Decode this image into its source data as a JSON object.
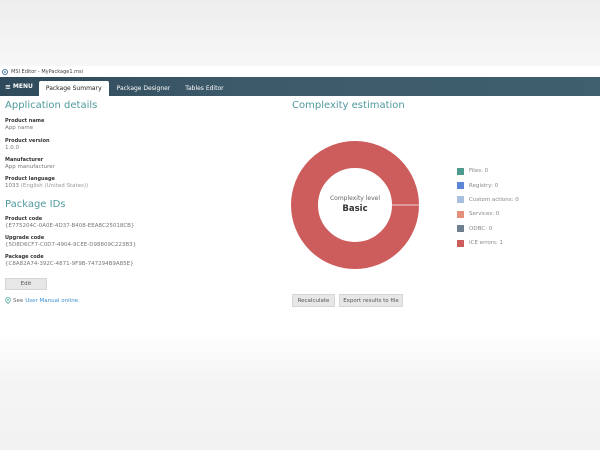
{
  "window": {
    "title": "MSI Editor - MyPackage1.msi"
  },
  "menu": {
    "menu_label": "MENU",
    "tabs": [
      {
        "label": "Package Summary",
        "active": true
      },
      {
        "label": "Package Designer",
        "active": false
      },
      {
        "label": "Tables Editor",
        "active": false
      }
    ]
  },
  "application_details": {
    "heading": "Application details",
    "product_name_label": "Product name",
    "product_name_value": "App name",
    "product_version_label": "Product version",
    "product_version_value": "1.0.0",
    "manufacturer_label": "Manufacturer",
    "manufacturer_value": "App manufacturer",
    "product_language_label": "Product language",
    "product_language_value": "1033",
    "product_language_hint": "(English (United States))"
  },
  "package_ids": {
    "heading": "Package IDs",
    "product_code_label": "Product code",
    "product_code_value": "{E775204C-0A0E-4D37-B408-EEA8C25018CB}",
    "upgrade_code_label": "Upgrade code",
    "upgrade_code_value": "{5D8D6CF7-C0D7-4904-9CEE-D98809C223B3}",
    "package_code_label": "Package code",
    "package_code_value": "{C8A82A74-392C-4871-9F9B-747294B9A85E}",
    "edit_label": "Edit"
  },
  "help": {
    "prefix": "See",
    "link_text": "User Manual online."
  },
  "complexity": {
    "heading": "Complexity estimation",
    "center_label": "Complexity level",
    "center_value": "Basic",
    "legend": [
      {
        "label": "Files: 0",
        "color": "#4f9a8e",
        "value": 0
      },
      {
        "label": "Registry: 0",
        "color": "#5b86d6",
        "value": 0
      },
      {
        "label": "Custom actions: 0",
        "color": "#a9bfe0",
        "value": 0
      },
      {
        "label": "Services: 0",
        "color": "#e38f7a",
        "value": 0
      },
      {
        "label": "ODBC: 0",
        "color": "#6f7f90",
        "value": 0
      },
      {
        "label": "ICE errors: 1",
        "color": "#cd5c5c",
        "value": 1
      }
    ],
    "recalculate_label": "Recalculate",
    "export_label": "Export results to file"
  }
}
